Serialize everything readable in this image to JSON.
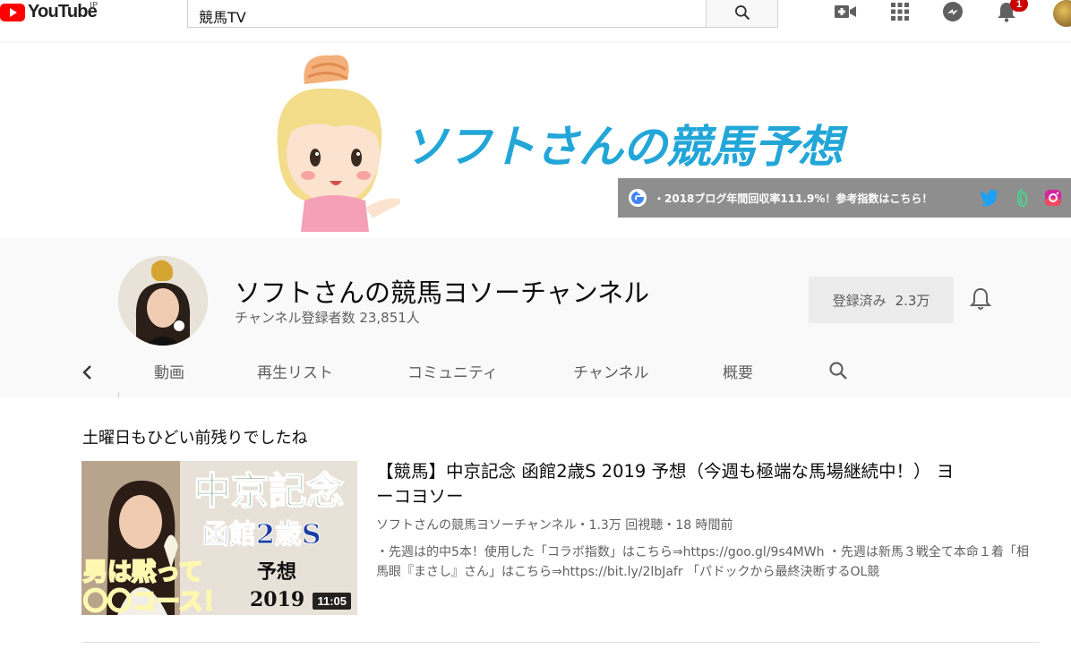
{
  "topbar": {
    "logo_text": "YouTube",
    "region": "JP",
    "search_value": "競馬TV",
    "notification_count": "1",
    "icons": [
      "create-video-icon",
      "apps-icon",
      "messages-icon",
      "notifications-icon"
    ]
  },
  "banner": {
    "title": "ソフトさんの競馬予想",
    "strip_text": "・2018ブログ年間回収率111.9%！参考指数はこちら！"
  },
  "channel": {
    "name": "ソフトさんの競馬ヨソーチャンネル",
    "subscribers": "チャンネル登録者数 23,851人",
    "subscribe_label": "登録済み",
    "subscribe_count": "2.3万"
  },
  "tabs": [
    {
      "label": "動画"
    },
    {
      "label": "再生リスト"
    },
    {
      "label": "コミュニティ"
    },
    {
      "label": "チャンネル"
    },
    {
      "label": "概要"
    }
  ],
  "section": {
    "title": "土曜日もひどい前残りでしたね"
  },
  "video": {
    "title": "【競馬】中京記念 函館2歳S 2019 予想（今週も極端な馬場継続中！） ヨーコヨソー",
    "meta": "ソフトさんの競馬ヨソーチャンネル・1.3万 回視聴・18 時間前",
    "description": "・先週は的中5本！使用した「コラボ指数」はこちら⇒https://goo.gl/9s4MWh ・先週は新馬３戦全て本命１着「相馬眼『まさし』さん」はこちら⇒https://bit.ly/2lbJafr 「パドックから最終決断するOL競",
    "duration": "11:05",
    "thumb_text_1": "中京記念",
    "thumb_text_2": "函館2歳S",
    "thumb_text_3": "男は黙って",
    "thumb_text_4": "〇〇コース！",
    "thumb_text_5": "予想",
    "thumb_text_6": "2019"
  },
  "colors": {
    "youtube_red": "#ff0000",
    "banner_blue": "#22a6d8",
    "thumb_green": "#1e6b2e",
    "thumb_blue": "#1b3fa5",
    "thumb_red": "#d21f1f"
  }
}
